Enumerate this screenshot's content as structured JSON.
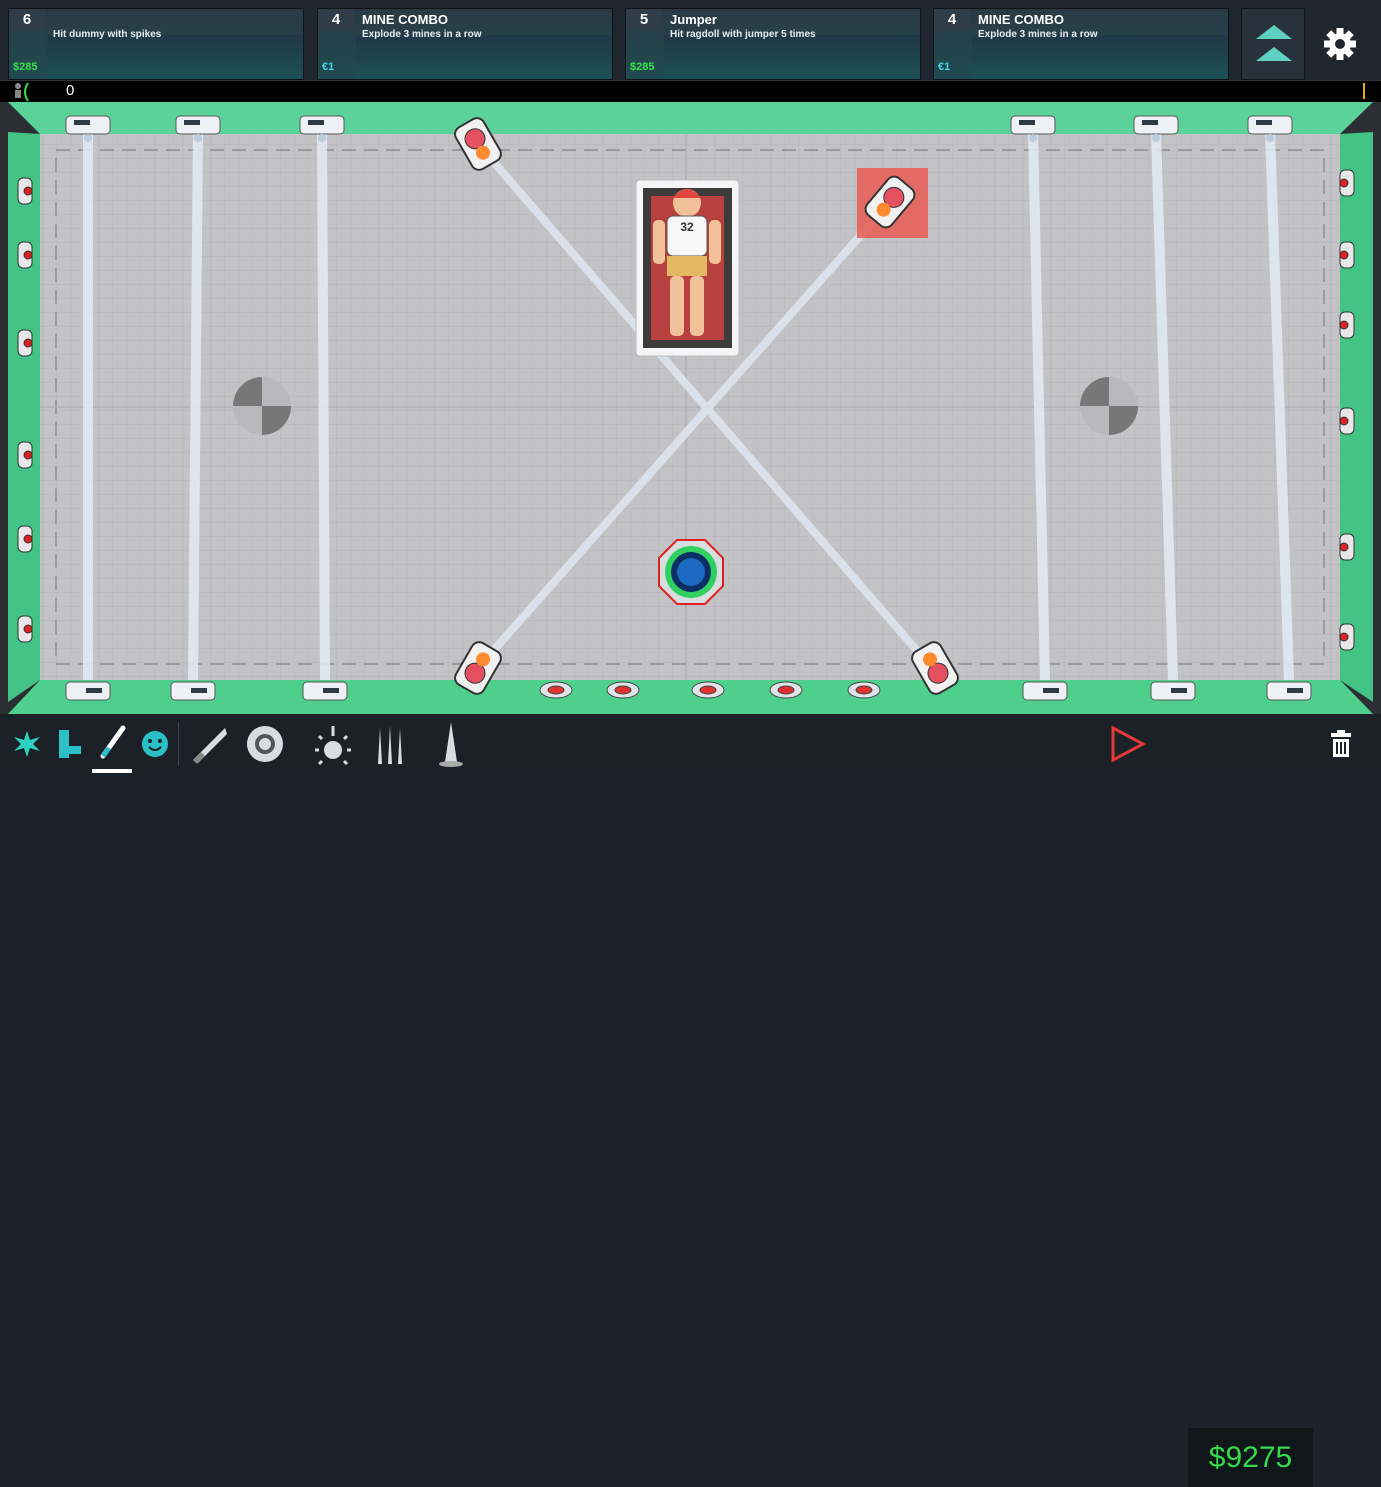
{
  "quests": [
    {
      "count": "6",
      "title": "",
      "description": "Hit dummy with spikes",
      "reward": "$285",
      "reward_color": "#37e04c"
    },
    {
      "count": "4",
      "title": "MINE COMBO",
      "description": "Explode 3 mines in a row",
      "reward": "€1",
      "reward_color": "#3fd7e6"
    },
    {
      "count": "5",
      "title": "Jumper",
      "description": "Hit ragdoll with jumper 5 times",
      "reward": "$285",
      "reward_color": "#37e04c"
    },
    {
      "count": "4",
      "title": "MINE COMBO",
      "description": "Explode 3 mines in a row",
      "reward": "€1",
      "reward_color": "#3fd7e6"
    }
  ],
  "progress": {
    "value": "0"
  },
  "dummy": {
    "number": "32"
  },
  "money": "$9275",
  "colors": {
    "accent_green": "#2ec27e",
    "laser": "#dfe8f5",
    "money": "#35d94a",
    "play": "#e53935"
  },
  "toolbar": {
    "tools": [
      "explosion-icon",
      "gun-icon",
      "blade-icon",
      "smiley-icon",
      "saw-blade-icon",
      "grinder-icon",
      "jumper-icon",
      "spikes-icon",
      "cone-spike-icon"
    ],
    "actions": [
      "play-icon",
      "trash-icon"
    ]
  }
}
